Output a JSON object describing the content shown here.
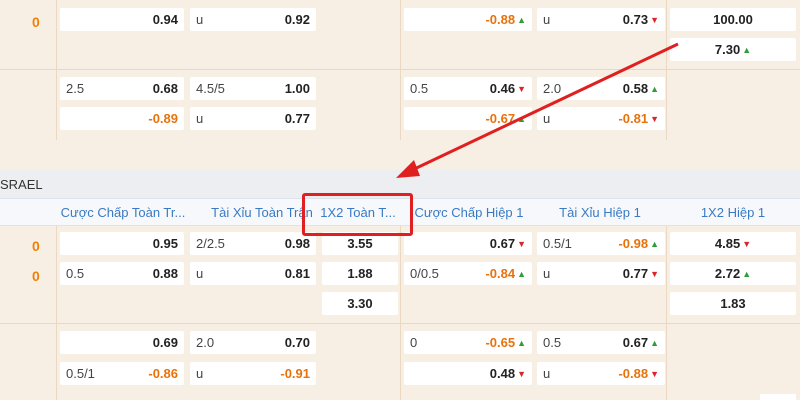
{
  "league_name": "SRAEL",
  "headers": [
    "Cược Chấp Toàn Tr...",
    "Tài Xỉu Toàn Trận",
    "1X2 Toàn T...",
    "Cược Chấp Hiệp 1",
    "Tài Xỉu Hiệp 1",
    "1X2 Hiệp 1"
  ],
  "match1": {
    "score": "0",
    "row1": {
      "hdp_full": {
        "odd": "0.94"
      },
      "ou_full": {
        "label": "u",
        "odd": "0.92"
      },
      "hdp_half": {
        "odd": "-0.88"
      },
      "ou_half": {
        "label": "u",
        "odd": "0.73"
      },
      "x12_half": {
        "odd": "100.00"
      }
    },
    "row2": {
      "x12_half": {
        "odd": "7.30"
      }
    }
  },
  "match1_extra": {
    "row1": {
      "hdp_full": {
        "label": "2.5",
        "odd": "0.68"
      },
      "ou_full": {
        "label": "4.5/5",
        "odd": "1.00"
      },
      "hdp_half": {
        "label": "0.5",
        "odd": "0.46"
      },
      "ou_half": {
        "label": "2.0",
        "odd": "0.58"
      }
    },
    "row2": {
      "hdp_full": {
        "odd": "-0.89"
      },
      "ou_full": {
        "label": "u",
        "odd": "0.77"
      },
      "hdp_half": {
        "odd": "-0.67"
      },
      "ou_half": {
        "label": "u",
        "odd": "-0.81"
      }
    }
  },
  "match2": {
    "score_home": "0",
    "score_away": "0",
    "row1": {
      "hdp_full": {
        "odd": "0.95"
      },
      "ou_full": {
        "label": "2/2.5",
        "odd": "0.98"
      },
      "x12_full": {
        "odd": "3.55"
      },
      "hdp_half": {
        "odd": "0.67"
      },
      "ou_half": {
        "label": "0.5/1",
        "odd": "-0.98"
      },
      "x12_half": {
        "odd": "4.85"
      }
    },
    "row2": {
      "hdp_full": {
        "label": "0.5",
        "odd": "0.88"
      },
      "ou_full": {
        "label": "u",
        "odd": "0.81"
      },
      "x12_full": {
        "odd": "1.88"
      },
      "hdp_half": {
        "label": "0/0.5",
        "odd": "-0.84"
      },
      "ou_half": {
        "label": "u",
        "odd": "0.77"
      },
      "x12_half": {
        "odd": "2.72"
      }
    },
    "row3": {
      "x12_full": {
        "odd": "3.30"
      },
      "x12_half": {
        "odd": "1.83"
      }
    }
  },
  "match2_extra": {
    "row1": {
      "hdp_full": {
        "odd": "0.69"
      },
      "ou_full": {
        "label": "2.0",
        "odd": "0.70"
      },
      "hdp_half": {
        "label": "0",
        "odd": "-0.65"
      },
      "ou_half": {
        "label": "0.5",
        "odd": "0.67"
      }
    },
    "row2": {
      "hdp_full": {
        "label": "0.5/1",
        "odd": "-0.86"
      },
      "ou_full": {
        "label": "u",
        "odd": "-0.91"
      },
      "hdp_half": {
        "odd": "0.48"
      },
      "ou_half": {
        "label": "u",
        "odd": "-0.88"
      }
    }
  },
  "colors": {
    "accent_orange": "#f0800a",
    "header_blue": "#3a7ac4",
    "highlight_red": "#e02020",
    "up_green": "#2e9e3a",
    "down_red": "#d8262a"
  },
  "icons": [
    "arrow-up-icon",
    "arrow-down-icon",
    "annotation-arrow"
  ]
}
